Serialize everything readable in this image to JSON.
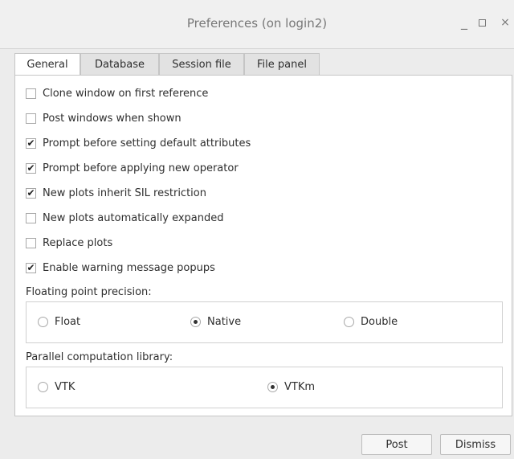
{
  "window": {
    "title": "Preferences (on login2)",
    "controls": {
      "minimize": "_",
      "close": "×"
    }
  },
  "tabs": [
    {
      "label": "General",
      "active": true
    },
    {
      "label": "Database",
      "active": false
    },
    {
      "label": "Session file",
      "active": false
    },
    {
      "label": "File panel",
      "active": false
    }
  ],
  "general": {
    "checkboxes": [
      {
        "label": "Clone window on first reference",
        "checked": false
      },
      {
        "label": "Post windows when shown",
        "checked": false
      },
      {
        "label": "Prompt before setting default attributes",
        "checked": true
      },
      {
        "label": "Prompt before applying new operator",
        "checked": true
      },
      {
        "label": "New plots inherit SIL restriction",
        "checked": true
      },
      {
        "label": "New plots automatically expanded",
        "checked": false
      },
      {
        "label": "Replace plots",
        "checked": false
      },
      {
        "label": "Enable warning message popups",
        "checked": true
      }
    ],
    "precision": {
      "label": "Floating point precision:",
      "options": [
        {
          "label": "Float",
          "selected": false
        },
        {
          "label": "Native",
          "selected": true
        },
        {
          "label": "Double",
          "selected": false
        }
      ]
    },
    "parallel": {
      "label": "Parallel computation library:",
      "options": [
        {
          "label": "VTK",
          "selected": false
        },
        {
          "label": "VTKm",
          "selected": true
        }
      ]
    }
  },
  "footer": {
    "post_label": "Post",
    "dismiss_label": "Dismiss"
  }
}
